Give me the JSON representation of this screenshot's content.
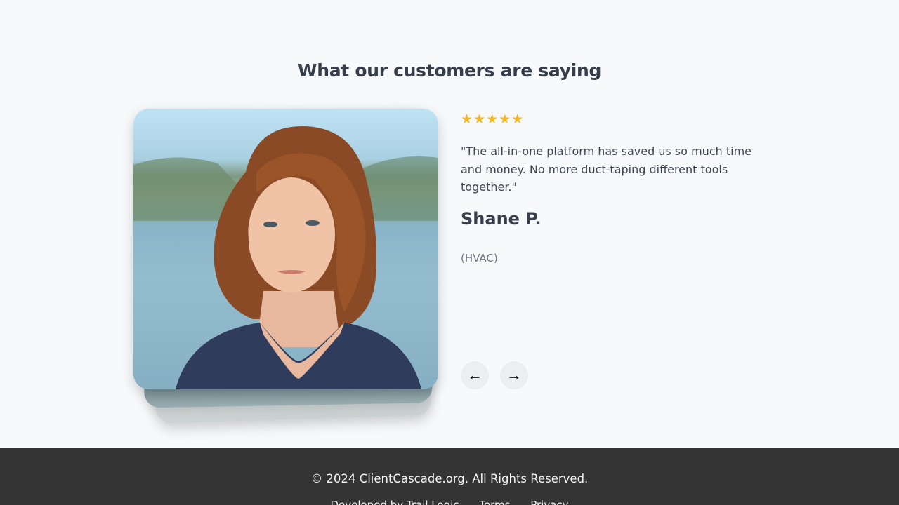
{
  "section": {
    "heading": "What our customers are saying"
  },
  "testimonial": {
    "rating": 5,
    "stars": "★★★★★",
    "quote": "\"The all-in-one platform has saved us so much time and money. No more duct-taping different tools together.\"",
    "name": "Shane P.",
    "role": "(HVAC)",
    "photo_icon": "customer-portrait-photo"
  },
  "navigation": {
    "prev_label": "←",
    "next_label": "→"
  },
  "footer": {
    "copyright": "© 2024 ClientCascade.org. All Rights Reserved.",
    "links": [
      "Developed by Trail Logic",
      "Terms",
      "Privacy"
    ]
  },
  "colors": {
    "background": "#f7f9fb",
    "star": "#f5b820",
    "footer": "#343434",
    "heading": "#363e4c"
  }
}
